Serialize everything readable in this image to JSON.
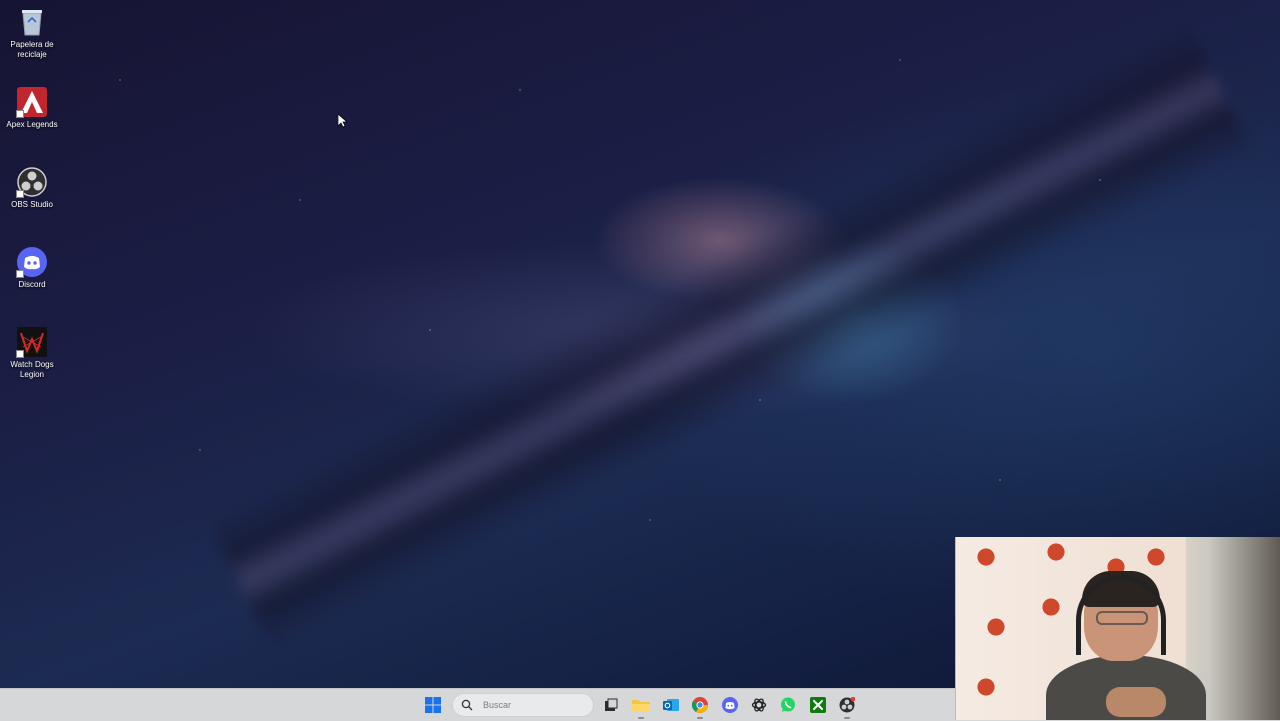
{
  "desktop": {
    "icons": [
      {
        "label": "Papelera de\nreciclaje",
        "icon": "recycle-bin-icon"
      },
      {
        "label": "Apex Legends",
        "icon": "apex-legends-icon"
      },
      {
        "label": "OBS Studio",
        "icon": "obs-studio-icon"
      },
      {
        "label": "Discord",
        "icon": "discord-icon"
      },
      {
        "label": "Watch Dogs\nLegion",
        "icon": "watch-dogs-legion-icon"
      }
    ]
  },
  "taskbar": {
    "search_placeholder": "Buscar",
    "apps": [
      "start-icon",
      "search-icon",
      "task-view-icon",
      "file-explorer-icon",
      "outlook-icon",
      "chrome-icon",
      "discord-icon",
      "chatgpt-icon",
      "whatsapp-icon",
      "xbox-icon",
      "obs-icon"
    ]
  },
  "colors": {
    "taskbar_bg": "#d6d7d9",
    "apex_red": "#c1252e",
    "discord_blurple": "#5865f2",
    "whatsapp_green": "#25d366",
    "xbox_green": "#107c10"
  }
}
